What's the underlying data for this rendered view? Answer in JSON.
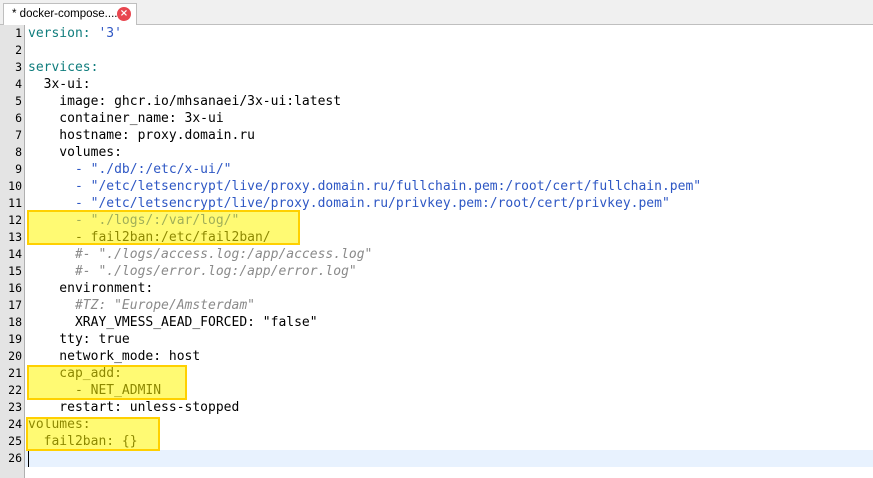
{
  "tab": {
    "title": "* docker-compose....",
    "close_icon": "close-icon",
    "close_color": "#e8464f"
  },
  "colors": {
    "key": "#107d7d",
    "string": "#2e57c4",
    "comment": "#8a8a8a",
    "highlight": "#fff500",
    "current_line": "#e8f2fe"
  },
  "editor": {
    "current_line": 26,
    "lines": [
      {
        "n": "1",
        "parts": [
          {
            "t": "version:",
            "c": "k"
          },
          {
            "t": " '3'",
            "c": "s"
          }
        ]
      },
      {
        "n": "2",
        "parts": []
      },
      {
        "n": "3",
        "parts": [
          {
            "t": "services:",
            "c": "k"
          }
        ]
      },
      {
        "n": "4",
        "parts": [
          {
            "t": "  3x-ui:",
            "c": ""
          }
        ]
      },
      {
        "n": "5",
        "parts": [
          {
            "t": "    image: ghcr.io/mhsanaei/3x-ui:latest",
            "c": ""
          }
        ]
      },
      {
        "n": "6",
        "parts": [
          {
            "t": "    container_name: 3x-ui",
            "c": ""
          }
        ]
      },
      {
        "n": "7",
        "parts": [
          {
            "t": "    hostname: proxy.domain.ru",
            "c": ""
          }
        ]
      },
      {
        "n": "8",
        "parts": [
          {
            "t": "    volumes:",
            "c": ""
          }
        ]
      },
      {
        "n": "9",
        "parts": [
          {
            "t": "      - \"./db/:/etc/x-ui/\"",
            "c": "s"
          }
        ]
      },
      {
        "n": "10",
        "parts": [
          {
            "t": "      - \"/etc/letsencrypt/live/proxy.domain.ru/fullchain.pem:/root/cert/fullchain.pem\"",
            "c": "s"
          }
        ]
      },
      {
        "n": "11",
        "parts": [
          {
            "t": "      - \"/etc/letsencrypt/live/proxy.domain.ru/privkey.pem:/root/cert/privkey.pem\"",
            "c": "s"
          }
        ]
      },
      {
        "n": "12",
        "parts": [
          {
            "t": "      - \"./logs/:/var/log/\"",
            "c": "s"
          }
        ]
      },
      {
        "n": "13",
        "parts": [
          {
            "t": "      - fail2ban:/etc/fail2ban/",
            "c": ""
          }
        ]
      },
      {
        "n": "14",
        "parts": [
          {
            "t": "      #- \"./logs/access.log:/app/access.log\"",
            "c": "c"
          }
        ]
      },
      {
        "n": "15",
        "parts": [
          {
            "t": "      #- \"./logs/error.log:/app/error.log\"",
            "c": "c"
          }
        ]
      },
      {
        "n": "16",
        "parts": [
          {
            "t": "    environment:",
            "c": ""
          }
        ]
      },
      {
        "n": "17",
        "parts": [
          {
            "t": "      #TZ: \"Europe/Amsterdam\"",
            "c": "c"
          }
        ]
      },
      {
        "n": "18",
        "parts": [
          {
            "t": "      XRAY_VMESS_AEAD_FORCED: \"false\"",
            "c": ""
          }
        ]
      },
      {
        "n": "19",
        "parts": [
          {
            "t": "    tty: true",
            "c": ""
          }
        ]
      },
      {
        "n": "20",
        "parts": [
          {
            "t": "    network_mode: host",
            "c": ""
          }
        ]
      },
      {
        "n": "21",
        "parts": [
          {
            "t": "    cap_add:",
            "c": ""
          }
        ]
      },
      {
        "n": "22",
        "parts": [
          {
            "t": "      - NET_ADMIN",
            "c": ""
          }
        ]
      },
      {
        "n": "23",
        "parts": [
          {
            "t": "    restart: unless-stopped",
            "c": ""
          }
        ]
      },
      {
        "n": "24",
        "parts": [
          {
            "t": "volumes:",
            "c": ""
          }
        ]
      },
      {
        "n": "25",
        "parts": [
          {
            "t": "  fail2ban: {}",
            "c": ""
          }
        ]
      },
      {
        "n": "26",
        "parts": []
      }
    ]
  }
}
